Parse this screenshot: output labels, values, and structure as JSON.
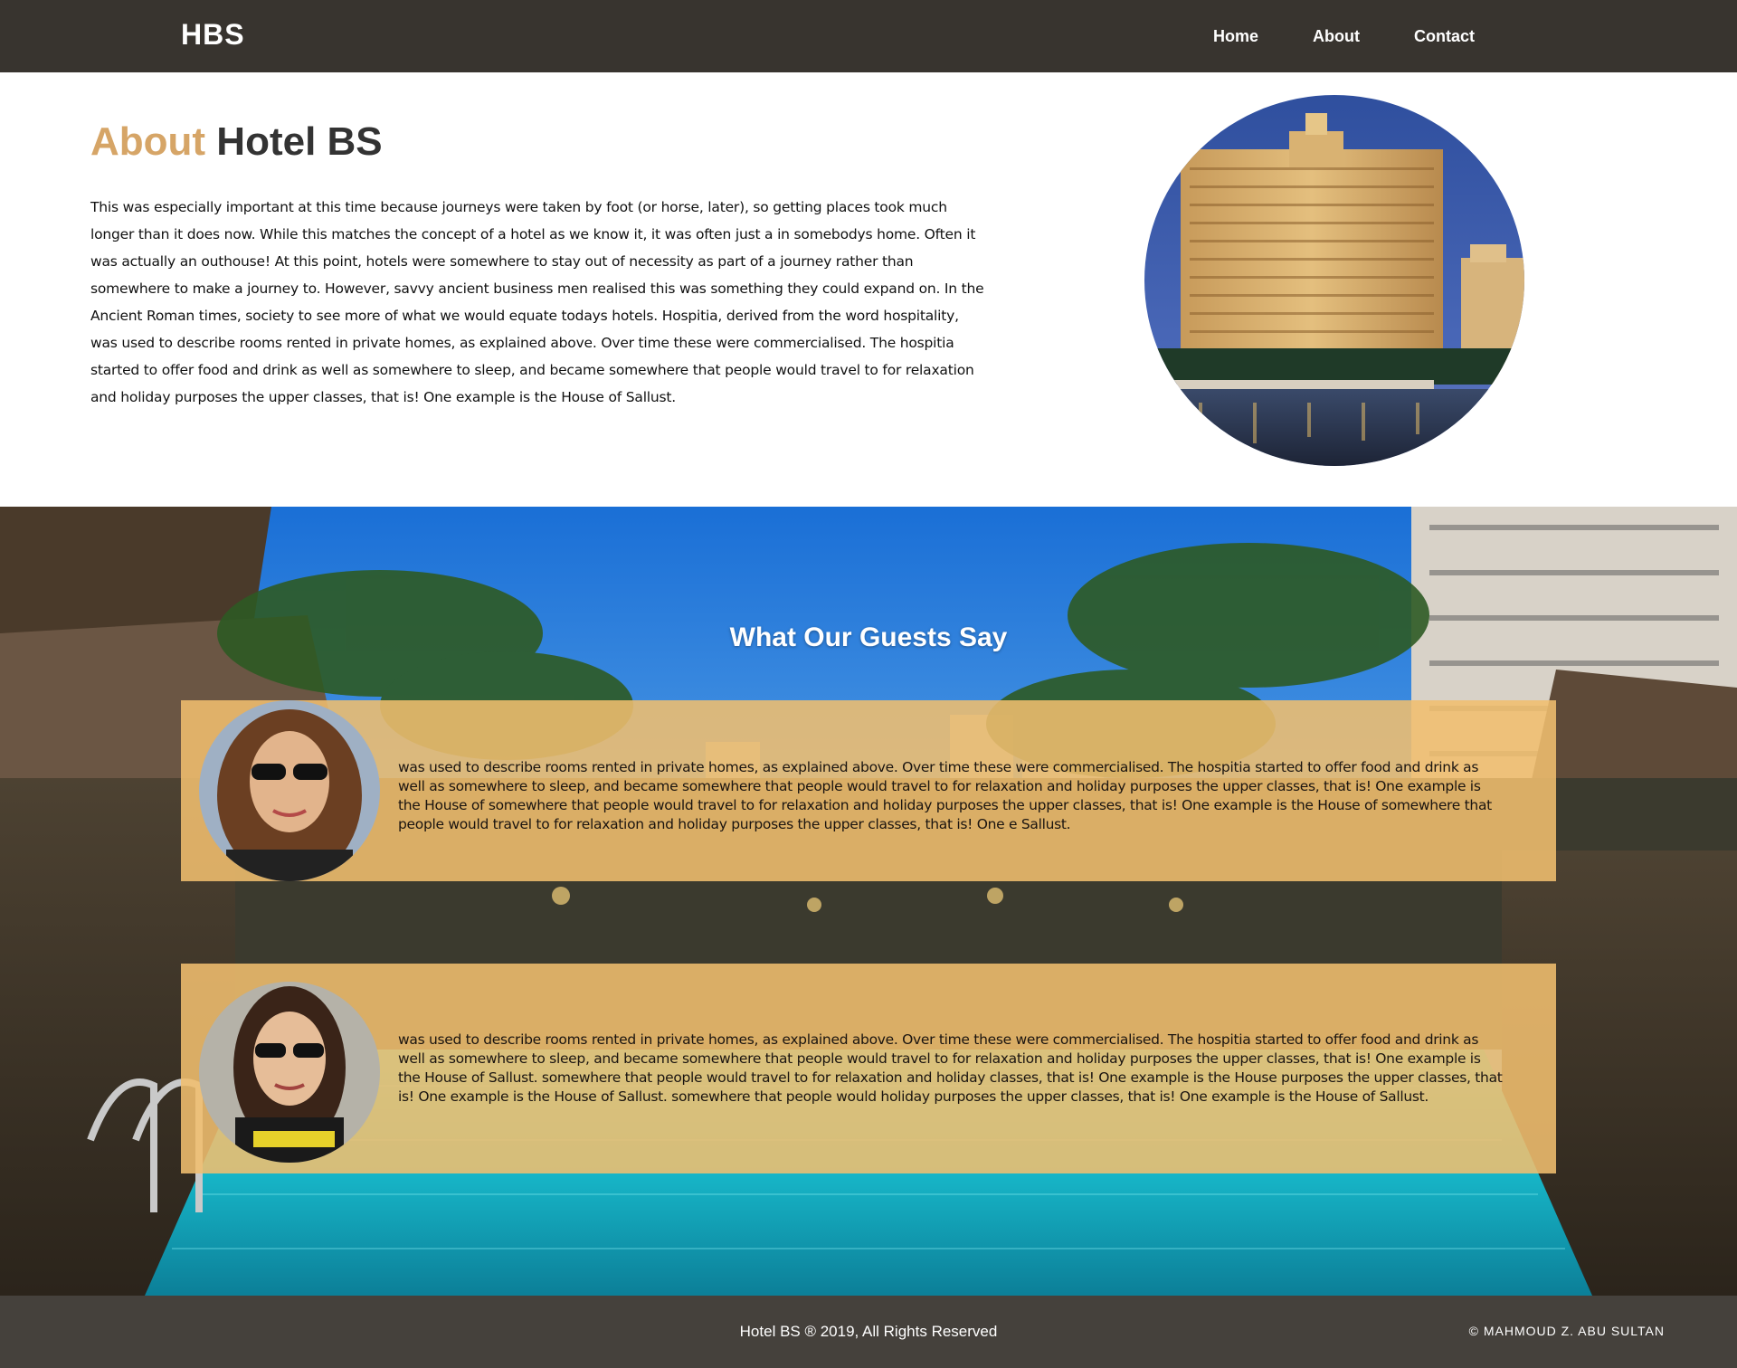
{
  "navbar": {
    "brand": "HBS",
    "links": [
      "Home",
      "About",
      "Contact"
    ]
  },
  "about": {
    "title_accent": "About",
    "title_rest": "Hotel BS",
    "body": "This was especially important at this time because journeys were taken by foot (or horse, later), so getting places took much longer than it does now. While this matches the concept of a hotel as we know it, it was often just a in somebodys home. Often it was actually an outhouse! At this point, hotels were somewhere to stay out of necessity as part of a journey rather than somewhere to make a journey to. However, savvy ancient business men realised this was something they could expand on. In the Ancient Roman times, society to see more of what we would equate todays hotels. Hospitia, derived from the word hospitality, was used to describe rooms rented in private homes, as explained above. Over time these were commercialised. The hospitia started to offer food and drink as well as somewhere to sleep, and became somewhere that people would travel to for relaxation and holiday purposes the upper classes, that is! One example is the House of Sallust."
  },
  "guests": {
    "title": "What Our Guests Say",
    "testimonials": [
      {
        "text": "was used to describe rooms rented in private homes, as explained above. Over time these were commercialised. The hospitia started to offer food and drink as well as somewhere to sleep, and became somewhere that people would travel to for relaxation and holiday purposes the upper classes, that is! One example is the House of somewhere that people would travel to for relaxation and holiday purposes the upper classes, that is! One example is the House of somewhere that people would travel to for relaxation and holiday purposes the upper classes, that is! One e Sallust."
      },
      {
        "text": "was used to describe rooms rented in private homes, as explained above. Over time these were commercialised. The hospitia started to offer food and drink as well as somewhere to sleep, and became somewhere that people would travel to for relaxation and holiday purposes the upper classes, that is! One example is the House of Sallust. somewhere that people would travel to for relaxation and holiday classes, that is! One example is the House purposes the upper classes, that is! One example is the House of Sallust. somewhere that people would holiday purposes the upper classes, that is! One example is the House of Sallust."
      }
    ]
  },
  "footer": {
    "copyright": "Hotel BS ® 2019, All Rights Reserved",
    "author": "©  MAHMOUD  Z.  ABU  SULTAN"
  },
  "colors": {
    "navbar": "#38342f",
    "accent": "#d6a567",
    "card": "#f0be6e",
    "footer": "#45413c"
  }
}
